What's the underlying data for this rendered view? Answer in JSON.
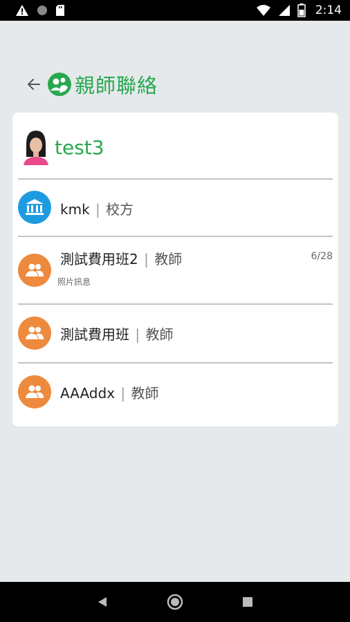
{
  "status_bar": {
    "time": "2:14",
    "icons": [
      "warning-icon",
      "record-icon",
      "sd-card-icon",
      "wifi-icon",
      "signal-icon",
      "battery-icon"
    ]
  },
  "header": {
    "back_icon": "arrow-left-icon",
    "logo_icon": "parent-teacher-logo-icon",
    "title": "親師聯絡"
  },
  "user": {
    "name": "test3"
  },
  "contacts": [
    {
      "icon": "school-building-icon",
      "icon_color": "#1e9be0",
      "name": "kmk",
      "separator": "|",
      "role": "校方",
      "subtitle": "",
      "count": ""
    },
    {
      "icon": "group-icon",
      "icon_color": "#ee8a3d",
      "name": "測試費用班2",
      "separator": "|",
      "role": "教師",
      "subtitle": "照片訊息",
      "count": "6/28"
    },
    {
      "icon": "group-icon",
      "icon_color": "#ee8a3d",
      "name": "測試費用班",
      "separator": "|",
      "role": "教師",
      "subtitle": "",
      "count": ""
    },
    {
      "icon": "group-icon",
      "icon_color": "#ee8a3d",
      "name": "AAAddx",
      "separator": "|",
      "role": "教師",
      "subtitle": "",
      "count": ""
    }
  ],
  "nav_bar": {
    "icons": [
      "back-triangle-icon",
      "home-circle-icon",
      "recents-square-icon"
    ]
  },
  "colors": {
    "accent": "#27a84f",
    "school_icon_bg": "#1e9be0",
    "group_icon_bg": "#ee8a3d",
    "background": "#e6e9eb"
  }
}
